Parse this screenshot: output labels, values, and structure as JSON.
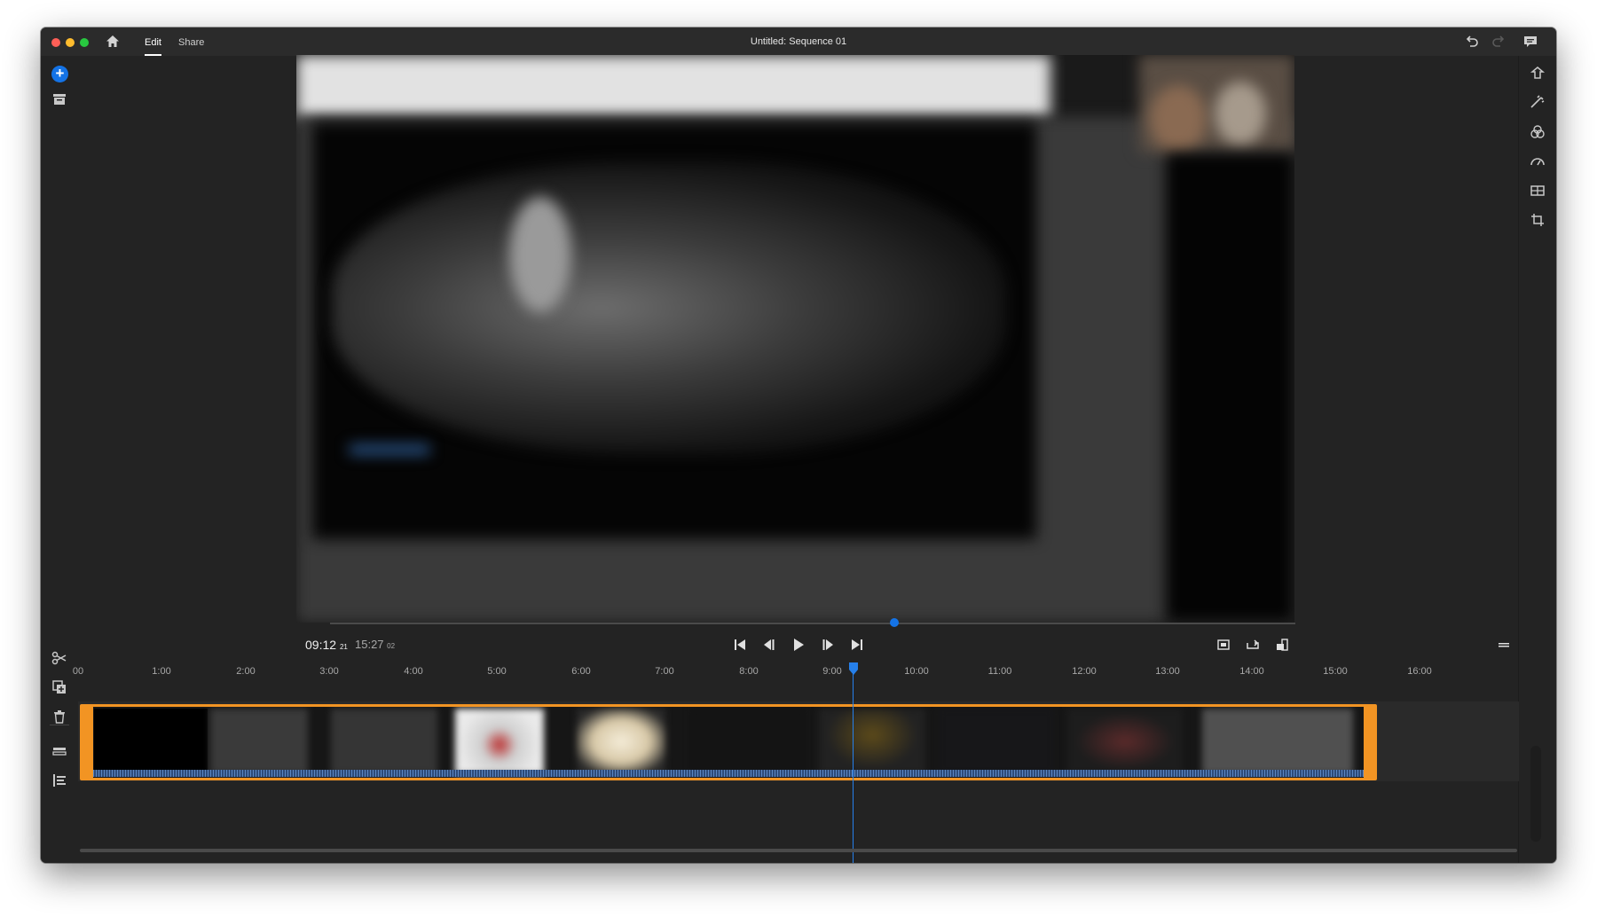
{
  "window": {
    "title": "Untitled: Sequence 01"
  },
  "tabs": [
    {
      "label": "Edit",
      "active": true
    },
    {
      "label": "Share",
      "active": false
    }
  ],
  "player": {
    "current_time": "09:12",
    "current_frames": "21",
    "total_time": "15:27",
    "total_frames": "02"
  },
  "ruler": {
    "ticks": [
      "00",
      "1:00",
      "2:00",
      "3:00",
      "4:00",
      "5:00",
      "6:00",
      "7:00",
      "8:00",
      "9:00",
      "10:00",
      "11:00",
      "12:00",
      "13:00",
      "14:00",
      "15:00",
      "16:00"
    ]
  },
  "icons": {
    "toolbar": [
      "home-icon",
      "undo-icon",
      "redo-icon",
      "comment-icon"
    ],
    "left": [
      "add-media-icon",
      "project-panel-icon",
      "split-icon",
      "duplicate-icon",
      "delete-icon",
      "track-height-icon",
      "align-left-icon"
    ],
    "right": [
      "shape-icon",
      "effects-icon",
      "color-icon",
      "speed-icon",
      "crop-grid-icon",
      "transform-icon"
    ],
    "playback": [
      "go-to-start-icon",
      "step-back-icon",
      "play-icon",
      "step-forward-icon",
      "go-to-end-icon",
      "fit-icon",
      "loop-icon",
      "aspect-icon",
      "hamburger-menu-icon"
    ]
  },
  "colors": {
    "accent": "#1473e6",
    "playhead": "#2680eb",
    "clip_border": "#f29423",
    "background": "#232323"
  }
}
